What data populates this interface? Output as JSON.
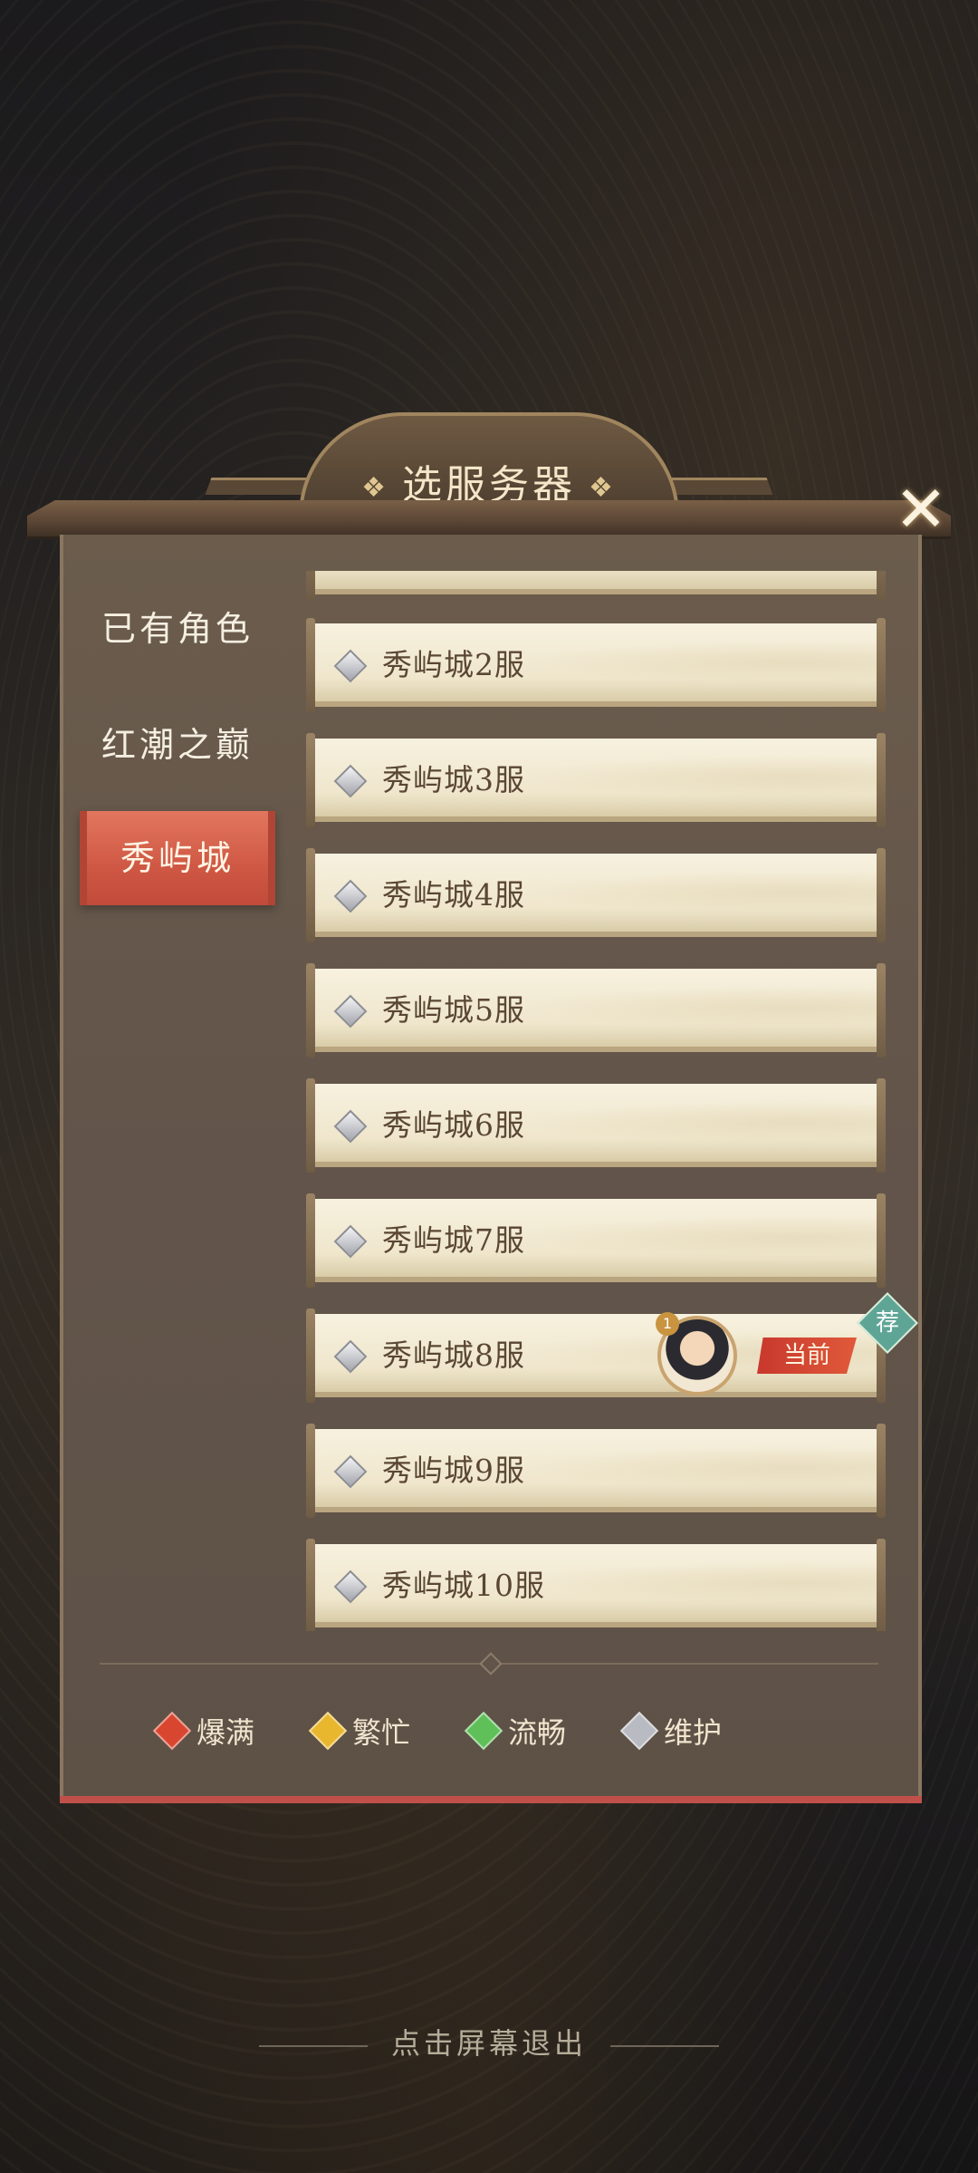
{
  "title": {
    "text": "选服务器",
    "ornament": "❖"
  },
  "sidebar": {
    "items": [
      {
        "label": "已有角色",
        "active": false
      },
      {
        "label": "红潮之巅",
        "active": false
      },
      {
        "label": "秀屿城",
        "active": true
      }
    ]
  },
  "servers": [
    {
      "name": "",
      "status": "maintenance"
    },
    {
      "name": "秀屿城2服",
      "status": "maintenance"
    },
    {
      "name": "秀屿城3服",
      "status": "maintenance"
    },
    {
      "name": "秀屿城4服",
      "status": "maintenance"
    },
    {
      "name": "秀屿城5服",
      "status": "maintenance"
    },
    {
      "name": "秀屿城6服",
      "status": "maintenance"
    },
    {
      "name": "秀屿城7服",
      "status": "maintenance"
    },
    {
      "name": "秀屿城8服",
      "status": "maintenance",
      "current": true,
      "current_label": "当前",
      "avatar_level": "1",
      "recommend_label": "荐"
    },
    {
      "name": "秀屿城9服",
      "status": "maintenance"
    },
    {
      "name": "秀屿城10服",
      "status": "maintenance"
    }
  ],
  "legend": [
    {
      "label": "爆满",
      "color": "#d9462f"
    },
    {
      "label": "繁忙",
      "color": "#e9b72e"
    },
    {
      "label": "流畅",
      "color": "#5fbf58"
    },
    {
      "label": "维护",
      "color": "#b9bbc2"
    }
  ],
  "footer": {
    "exit_hint": "点击屏幕退出"
  },
  "icons": {
    "close": "close-icon",
    "status": "diamond-status-icon"
  }
}
